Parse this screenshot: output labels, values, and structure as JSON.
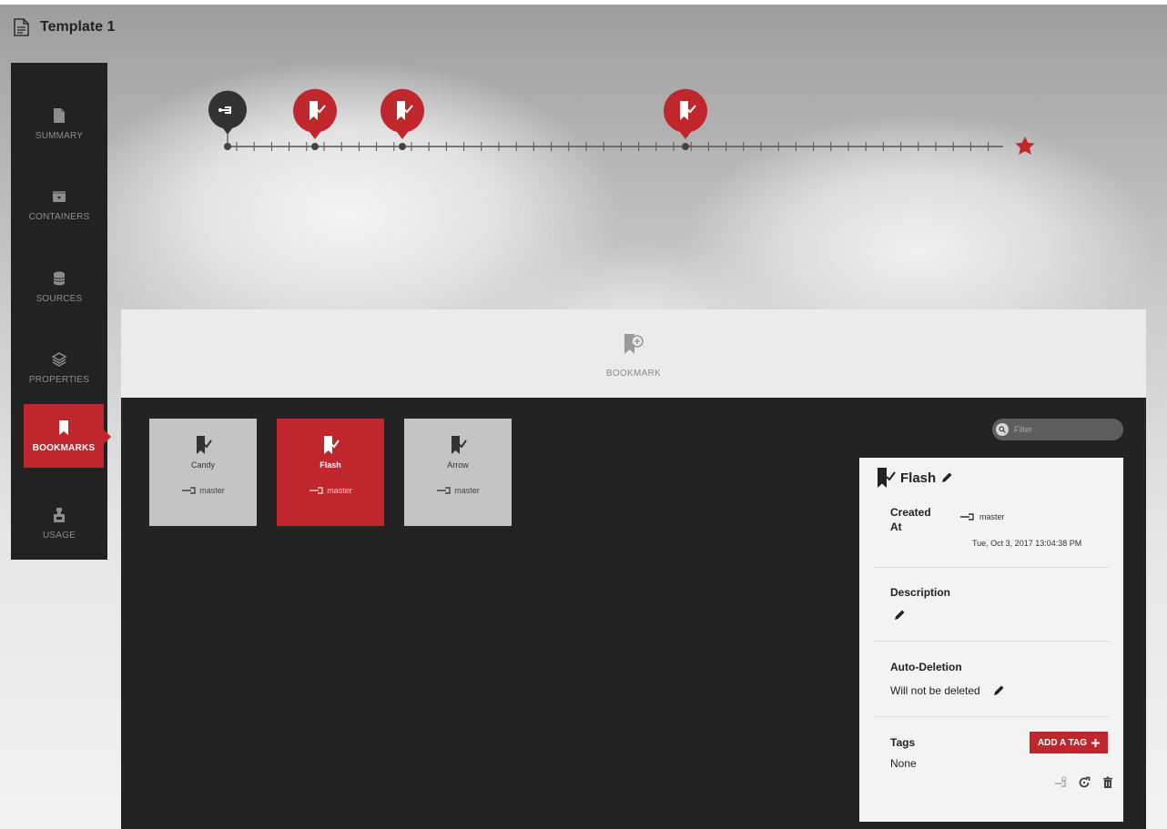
{
  "app": {
    "title": "Template 1"
  },
  "sidebar": {
    "items": [
      {
        "label": "SUMMARY",
        "icon": "document-icon"
      },
      {
        "label": "CONTAINERS",
        "icon": "container-icon"
      },
      {
        "label": "SOURCES",
        "icon": "database-icon"
      },
      {
        "label": "PROPERTIES",
        "icon": "layers-icon"
      },
      {
        "label": "BOOKMARKS",
        "icon": "bookmark-icon",
        "active": true
      },
      {
        "label": "USAGE",
        "icon": "usage-icon"
      }
    ]
  },
  "timeline": {
    "markers": [
      {
        "type": "branch",
        "icon": "branch-icon"
      },
      {
        "type": "bookmark",
        "icon": "bookmark-check-icon"
      },
      {
        "type": "bookmark",
        "icon": "bookmark-check-icon"
      },
      {
        "type": "bookmark",
        "icon": "bookmark-check-icon"
      }
    ],
    "end_icon": "star-icon"
  },
  "bookmark_bar": {
    "label": "BOOKMARK",
    "icon": "add-bookmark-icon"
  },
  "cards": [
    {
      "name": "Candy",
      "branch": "master",
      "selected": false
    },
    {
      "name": "Flash",
      "branch": "master",
      "selected": true
    },
    {
      "name": "Arrow",
      "branch": "master",
      "selected": false
    }
  ],
  "filter": {
    "placeholder": "Filter"
  },
  "detail": {
    "name": "Flash",
    "created_label": "Created At",
    "created_label_line1": "Created",
    "created_label_line2": "At",
    "created_branch": "master",
    "created_timestamp": "Tue, Oct 3, 2017 13:04:38 PM",
    "description_label": "Description",
    "auto_deletion_label": "Auto-Deletion",
    "auto_deletion_value": "Will not be deleted",
    "tags_label": "Tags",
    "tags_value": "None",
    "add_tag_label": "ADD A TAG"
  },
  "colors": {
    "accent": "#c0272d",
    "sidebar_bg": "#222222",
    "panel_bg": "#232323"
  }
}
